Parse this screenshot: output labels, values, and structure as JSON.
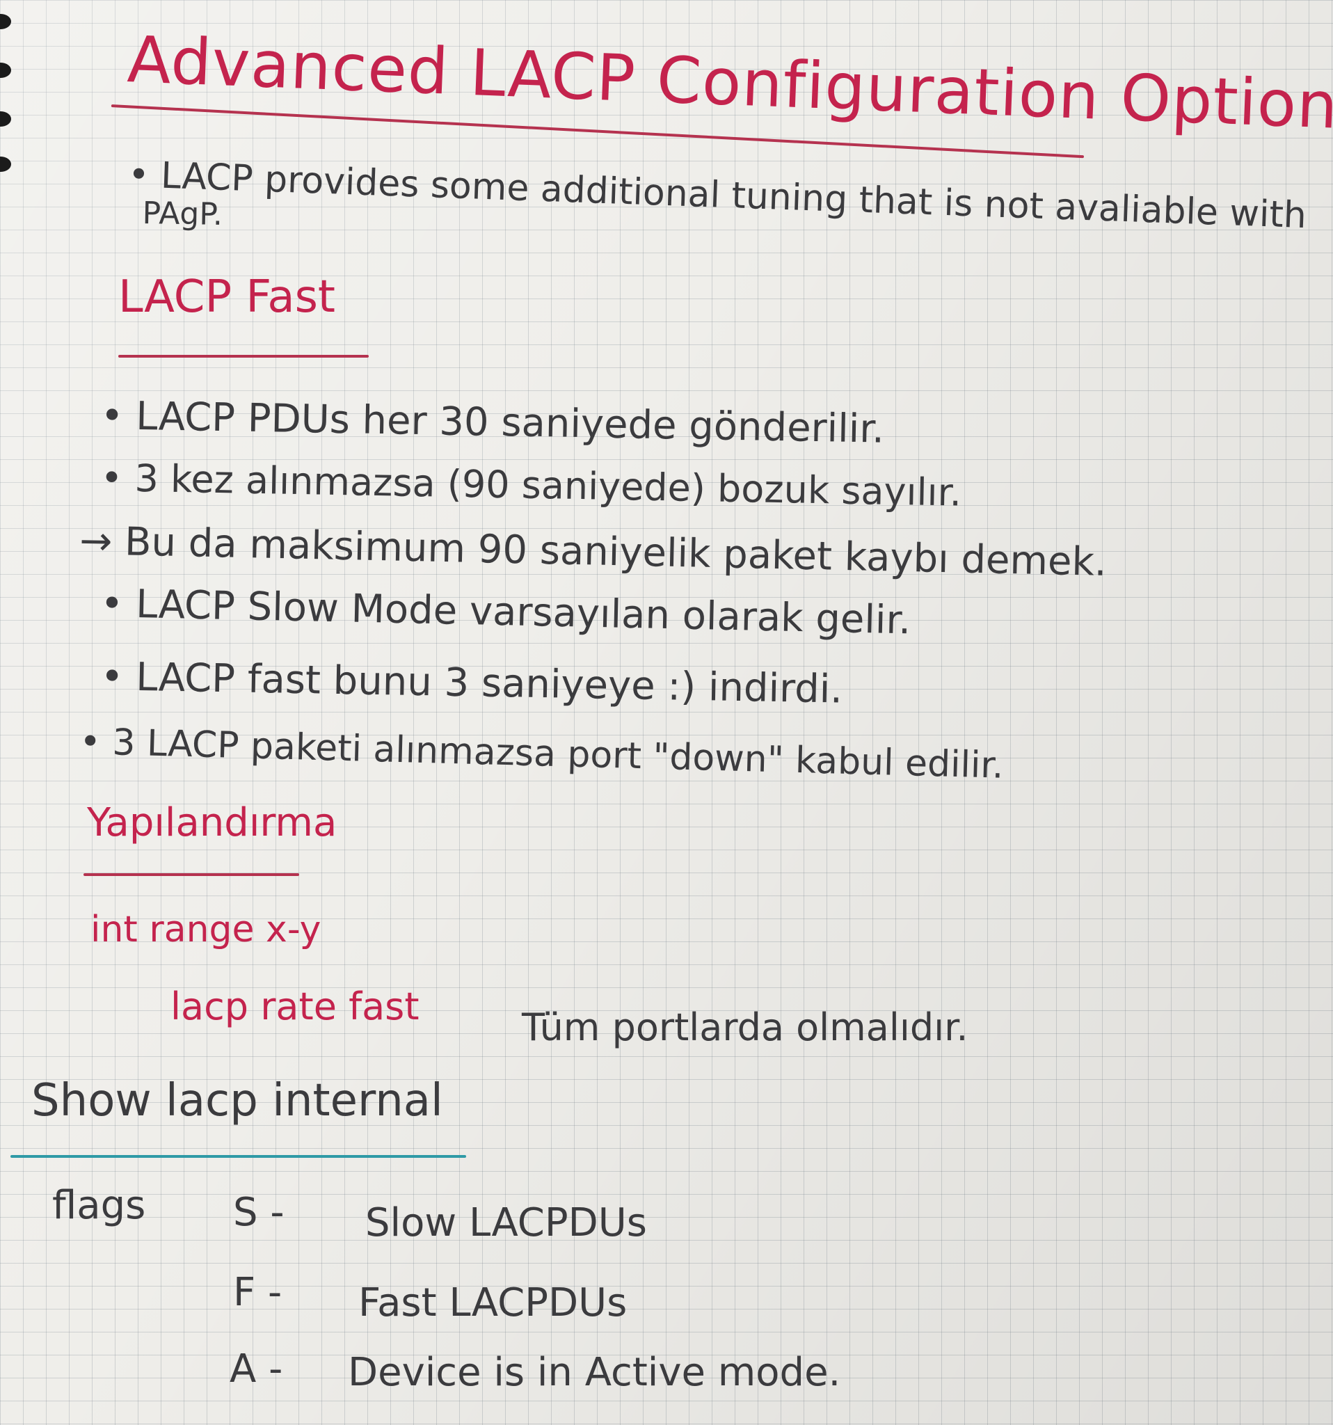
{
  "title": "Advanced LACP Configuration Options",
  "intro": {
    "line1": "• LACP provides some additional tuning that is not avaliable with",
    "line2": "PAgP."
  },
  "lacp_fast": {
    "heading": "LACP Fast",
    "lines": [
      "• LACP PDUs her 30 saniyede gönderilir.",
      "• 3 kez alınmazsa (90 saniyede) bozuk sayılır.",
      "→ Bu da maksimum 90 saniyelik paket kaybı demek.",
      "• LACP Slow Mode varsayılan olarak gelir.",
      "• LACP fast bunu 3 saniyeye :) indirdi.",
      "• 3 LACP paketi alınmazsa port \"down\" kabul edilir."
    ]
  },
  "config": {
    "heading": "Yapılandırma",
    "cmd1": "int range x-y",
    "cmd2": "lacp rate fast",
    "note": "Tüm portlarda olmalıdır."
  },
  "show": {
    "heading": "Show lacp internal",
    "flags_label": "flags",
    "flags": [
      {
        "key": "S -",
        "desc": "Slow LACPDUs"
      },
      {
        "key": "F -",
        "desc": "Fast LACPDUs"
      },
      {
        "key": "A -",
        "desc": "Device is in Active mode."
      }
    ]
  },
  "colors": {
    "ink_red": "#c4234d",
    "ink_dark": "#3b3b3e",
    "rule_red": "#b5324f",
    "rule_teal": "#2f9aa6"
  }
}
